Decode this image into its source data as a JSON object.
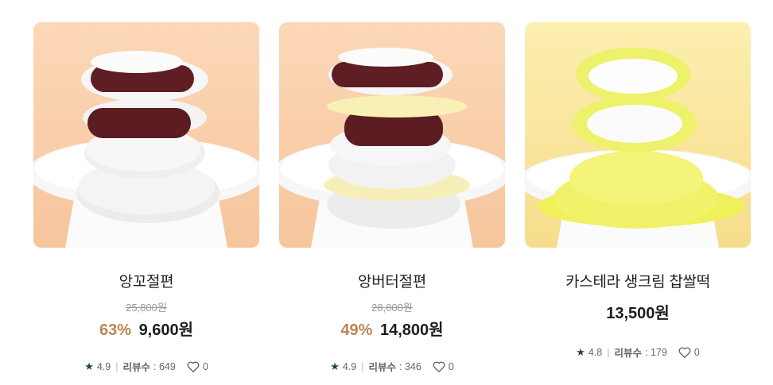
{
  "products": [
    {
      "name": "앙꼬절편",
      "original_price": "25,800원",
      "discount_rate": "63%",
      "price": "9,600원",
      "rating": "4.9",
      "review_label": "리뷰수",
      "review_count": ": 649",
      "likes": "0",
      "image_icon": "bean-paste-rice-cake-image",
      "bg_color": "#f9d5b4"
    },
    {
      "name": "앙버터절편",
      "original_price": "28,800원",
      "discount_rate": "49%",
      "price": "14,800원",
      "rating": "4.9",
      "review_label": "리뷰수",
      "review_count": ": 346",
      "likes": "0",
      "image_icon": "bean-butter-rice-cake-image",
      "bg_color": "#f9d5b4"
    },
    {
      "name": "카스테라 생크림 찹쌀떡",
      "price": "13,500원",
      "rating": "4.8",
      "review_label": "리뷰수",
      "review_count": ": 179",
      "likes": "0",
      "image_icon": "castella-cream-mochi-image",
      "bg_color": "#fbe9a6"
    }
  ],
  "colors": {
    "discount": "#b98754",
    "star": "#1f4b2a",
    "price": "#1d1d1d"
  }
}
